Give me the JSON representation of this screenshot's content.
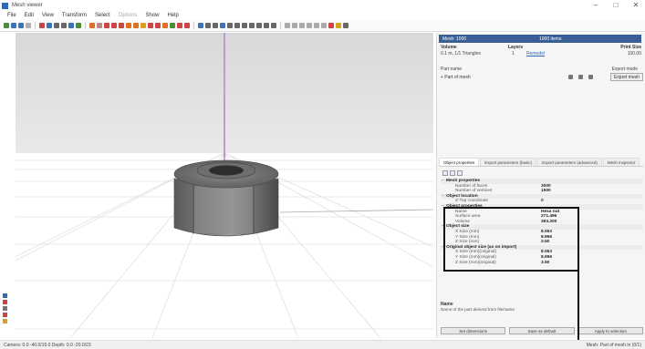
{
  "window": {
    "title": "Mesh viewer",
    "controls": [
      "–",
      "□",
      "✕"
    ]
  },
  "menu": [
    "File",
    "Edit",
    "View",
    "Transform",
    "Select",
    "Options",
    "Show",
    "Help"
  ],
  "toolbar_colors": [
    "#4a8d3a",
    "#3a73b8",
    "#3a73b8",
    "#b0b0b0",
    "#c44",
    "#3a73b8",
    "#666",
    "#666",
    "#3a73b8",
    "#4a8d3a",
    "#e07020",
    "#b88",
    "#c44",
    "#c44",
    "#c44",
    "#e07020",
    "#e07020",
    "#d9a020",
    "#c44",
    "#c44",
    "#e07020",
    "#4a8d3a",
    "#c44",
    "#c44",
    "#3a73b8",
    "#666",
    "#666",
    "#3a73b8",
    "#666",
    "#666",
    "#666",
    "#666",
    "#666",
    "#666",
    "#666",
    "#aaa",
    "#aaa",
    "#aaa",
    "#aaa",
    "#aaa",
    "#aaa",
    "#c44",
    "#d9a020",
    "#666"
  ],
  "panel": {
    "top_select_left": "Mesh: 1000",
    "top_select_right": "1000 items",
    "volume_label": "Volume",
    "volume_value": "0.1 m, 1/1 Triangles",
    "layers_label": "Layers",
    "layers_value": "1",
    "layers_link": "Remodel",
    "print_size_label": "Print Size",
    "print_size_value": "100.00",
    "subheader": "Part name",
    "export_mode": "Export mode",
    "list_item": "+ Part of mesh",
    "export_button": "Export mesh",
    "tabs": [
      "Object properties",
      "Export parameters (basic)",
      "Export parameters (advanced)",
      "Mesh inspector"
    ],
    "grid": [
      {
        "cat": true,
        "k": "Mesh properties"
      },
      {
        "k": "Number of faces",
        "v": "3000"
      },
      {
        "k": "Number of vertices",
        "v": "1500"
      },
      {
        "cat": true,
        "k": "Object location"
      },
      {
        "k": "Z-Top coordinate",
        "v": "0"
      },
      {
        "cat": true,
        "k": "Object properties"
      },
      {
        "k": "Name",
        "v": "Hexa nut"
      },
      {
        "k": "Surface area",
        "v": "271.496"
      },
      {
        "k": "Volume",
        "v": "393.200"
      },
      {
        "cat": true,
        "k": "Object size"
      },
      {
        "k": "X Size (mm)",
        "v": "8.063"
      },
      {
        "k": "Y Size (mm)",
        "v": "8.996"
      },
      {
        "k": "Z Size (mm)",
        "v": "3.50"
      },
      {
        "cat": true,
        "k": "Original object size (as on import)"
      },
      {
        "k": "X Size (mm)(original)",
        "v": "8.063"
      },
      {
        "k": "Y Size (mm)(original)",
        "v": "8.996"
      },
      {
        "k": "Z Size (mm)(original)",
        "v": "3.50"
      }
    ],
    "desc_title": "Name",
    "desc_text": "Name of the part derived from file/name",
    "buttons": [
      "Set dimensions",
      "Save as default",
      "Apply to selection"
    ]
  },
  "status": {
    "left": "Camera: 0.0 -40.0/15.0    Depth: 0.0 -20.0/23",
    "right": "Mesh: Part of mesh in (0/1)"
  },
  "palette": [
    "#2d6bb5",
    "#c44",
    "#777",
    "#c44",
    "#d9a020"
  ]
}
